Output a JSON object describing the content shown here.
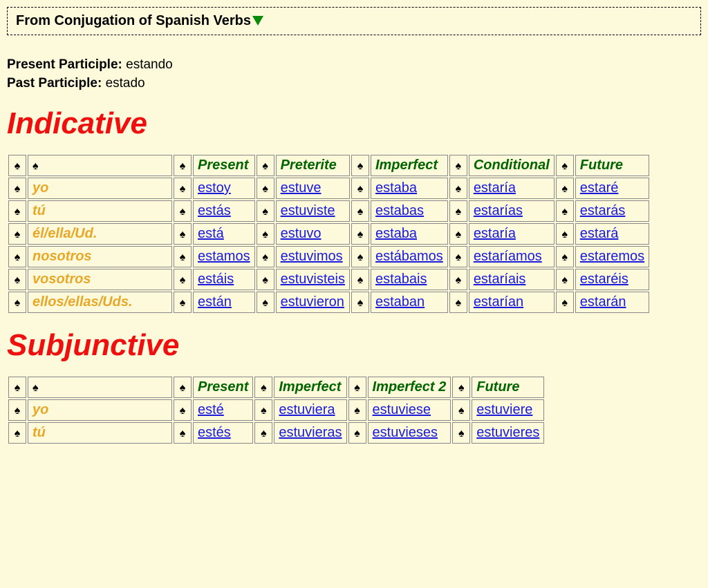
{
  "header": {
    "title": "From Conjugation of Spanish Verbs"
  },
  "participles": {
    "present_label": "Present Participle:",
    "present_value": "estando",
    "past_label": "Past Participle:",
    "past_value": "estado"
  },
  "indicative": {
    "heading": "Indicative",
    "tenses": [
      "Present",
      "Preterite",
      "Imperfect",
      "Conditional",
      "Future"
    ],
    "pronouns": [
      "yo",
      "tú",
      "él/ella/Ud.",
      "nosotros",
      "vosotros",
      "ellos/ellas/Uds."
    ],
    "forms": [
      [
        "estoy",
        "estuve",
        "estaba",
        "estaría",
        "estaré"
      ],
      [
        "estás",
        "estuviste",
        "estabas",
        "estarías",
        "estarás"
      ],
      [
        "está",
        "estuvo",
        "estaba",
        "estaría",
        "estará"
      ],
      [
        "estamos",
        "estuvimos",
        "estábamos",
        "estaríamos",
        "estaremos"
      ],
      [
        "estáis",
        "estuvisteis",
        "estabais",
        "estaríais",
        "estaréis"
      ],
      [
        "están",
        "estuvieron",
        "estaban",
        "estarían",
        "estarán"
      ]
    ]
  },
  "subjunctive": {
    "heading": "Subjunctive",
    "tenses": [
      "Present",
      "Imperfect",
      "Imperfect 2",
      "Future"
    ],
    "pronouns": [
      "yo",
      "tú"
    ],
    "forms": [
      [
        "esté",
        "estuviera",
        "estuviese",
        "estuviere"
      ],
      [
        "estés",
        "estuvieras",
        "estuvieses",
        "estuvieres"
      ]
    ]
  }
}
